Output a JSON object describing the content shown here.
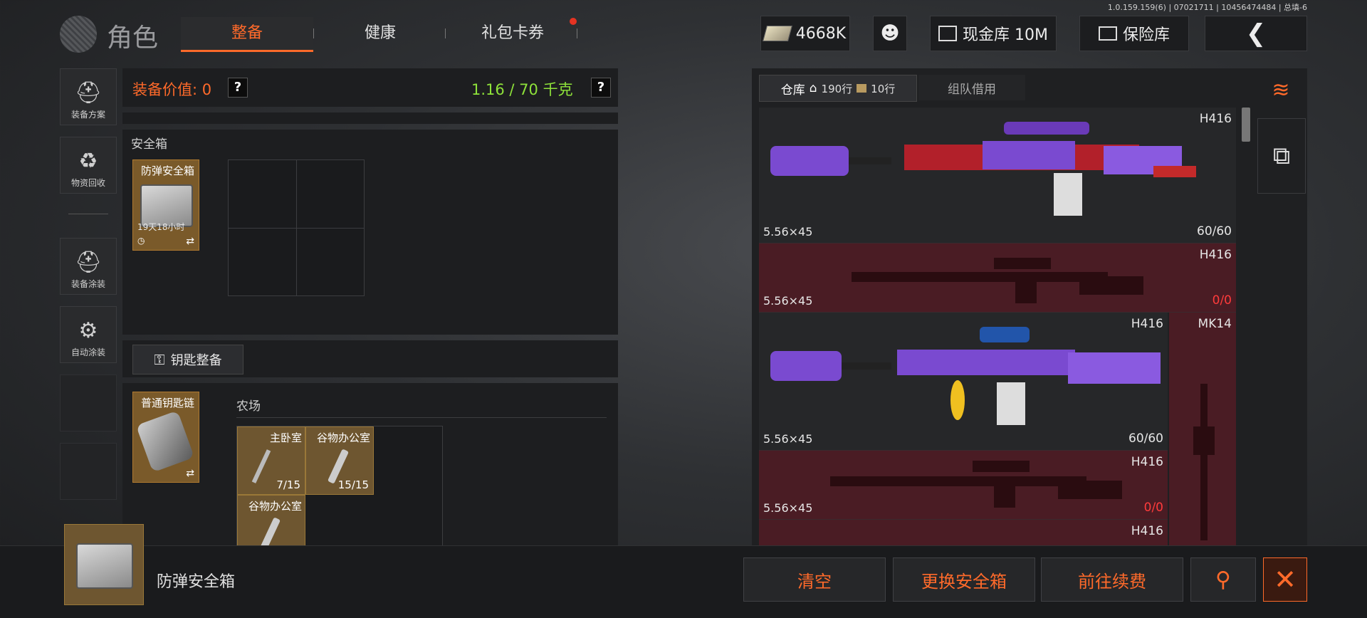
{
  "version": "1.0.159.159(6) | 07021711 | 10456474484 | 总填-6",
  "header": {
    "title": "角色",
    "tabs": [
      {
        "label": "整备",
        "active": true
      },
      {
        "label": "健康",
        "active": false
      },
      {
        "label": "礼包卡券",
        "active": false,
        "badge": true
      }
    ],
    "currency": "4668K",
    "cash_vault": "现金库 10M",
    "safe_vault": "保险库"
  },
  "sidebar": {
    "items": [
      {
        "label": "装备方案",
        "icon": "helmet-grid-icon"
      },
      {
        "label": "物资回收",
        "icon": "recycle-face-icon"
      },
      {
        "label": "装备涂装",
        "icon": "helmet-paint-icon"
      },
      {
        "label": "自动涂装",
        "icon": "brush-gear-icon"
      }
    ]
  },
  "equipment": {
    "value_label": "装备价值: 0",
    "weight": "1.16 / 70 千克",
    "help": "?",
    "safebox_title": "安全箱",
    "safebox_item": {
      "name": "防弹安全箱",
      "time": "19天18小时"
    },
    "keys_button": "钥匙整备",
    "keychain_item": {
      "name": "普通钥匙链"
    },
    "map_name": "农场",
    "keys": [
      {
        "name": "主卧室",
        "count": "7/15"
      },
      {
        "name": "谷物办公室",
        "count": "15/15"
      },
      {
        "name": "谷物办公室",
        "count": ""
      }
    ]
  },
  "warehouse": {
    "tab_label": "仓库",
    "rows_a": "190行",
    "rows_b": "10行",
    "tab_team": "组队借用",
    "items": [
      {
        "name": "H416",
        "caliber": "5.56×45",
        "ammo": "60/60",
        "state": "skin"
      },
      {
        "name": "H416",
        "caliber": "5.56×45",
        "ammo": "0/0",
        "state": "missing"
      },
      {
        "name": "H416",
        "caliber": "5.56×45",
        "ammo": "60/60",
        "state": "skin"
      },
      {
        "name": "H416",
        "caliber": "5.56×45",
        "ammo": "0/0",
        "state": "missing"
      },
      {
        "name": "H416",
        "caliber": "",
        "ammo": "",
        "state": "missing"
      }
    ],
    "side_item": {
      "name": "MK14"
    }
  },
  "footer": {
    "selected_item": "防弹安全箱",
    "buttons": [
      "清空",
      "更换安全箱",
      "前往续费"
    ]
  },
  "colors": {
    "accent": "#ff6a2a",
    "weight_green": "#8ee23a",
    "missing_red": "#ff3b3b"
  }
}
